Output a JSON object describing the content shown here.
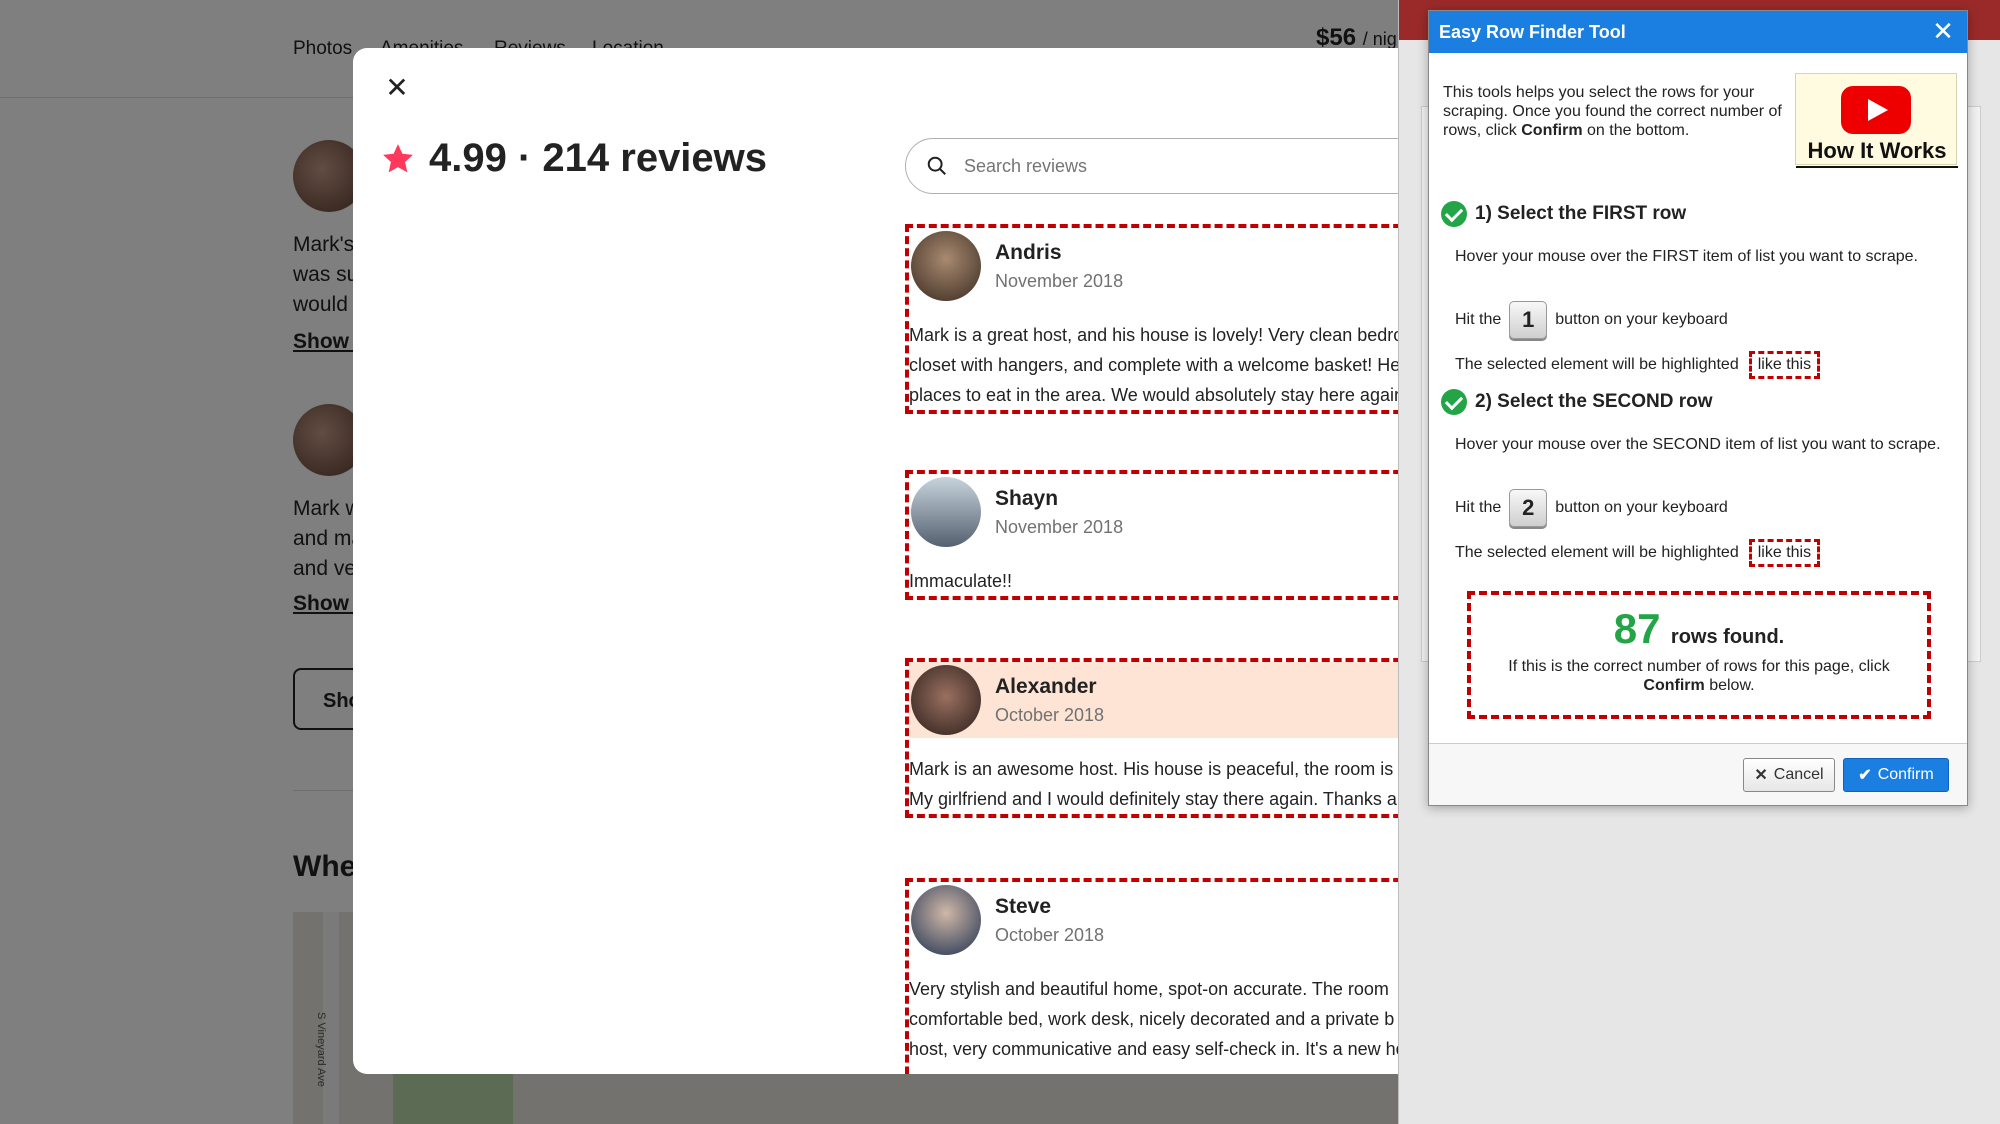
{
  "background": {
    "nav": [
      "Photos",
      "Amenities",
      "Reviews",
      "Location"
    ],
    "price": "$56",
    "price_unit": "/ nig",
    "snippets": [
      "Mark's",
      "was su",
      "would",
      "Mark w",
      "and ma",
      "and ve"
    ],
    "show_more": "Show r",
    "show_button": "Sho",
    "where_heading": "Whe",
    "map_label": "S Vineyard Ave"
  },
  "modal": {
    "rating": "4.99 · 214 reviews",
    "search_placeholder": "Search reviews",
    "reviews": [
      {
        "name": "Andris",
        "date": "November 2018",
        "lines": [
          "Mark is a great host, and his house is lovely! Very clean bedroo",
          "closet with hangers, and complete with a welcome basket! He",
          "places to eat in the area. We would absolutely stay here again"
        ]
      },
      {
        "name": "Shayn",
        "date": "November 2018",
        "lines": [
          "Immaculate!!"
        ]
      },
      {
        "name": "Alexander",
        "date": "October 2018",
        "lines": [
          "Mark is an awesome host. His house is peaceful, the room is sp",
          "My girlfriend and I would definitely stay there again. Thanks a"
        ]
      },
      {
        "name": "Steve",
        "date": "October 2018",
        "lines": [
          "Very stylish and beautiful home, spot-on accurate. The room",
          "comfortable bed, work desk, nicely decorated and a private b",
          "host, very communicative and easy self-check in. It's a new ho"
        ]
      }
    ]
  },
  "dialog": {
    "title": "Easy Row Finder Tool",
    "intro_pre": "This tools helps you select the rows for your scraping. Once you found the correct number of rows, click ",
    "intro_bold": "Confirm",
    "intro_post": " on the bottom.",
    "video_label": "How It Works",
    "step1": {
      "title": "1) Select the FIRST row",
      "text": "Hover your mouse over the FIRST item of list you want to scrape.",
      "hit_pre": "Hit the",
      "key": "1",
      "hit_post": "button on your keyboard",
      "highlight": "The selected element will be highlighted",
      "like_this": "like this"
    },
    "step2": {
      "title": "2) Select the SECOND row",
      "text": "Hover your mouse over the SECOND item of list you want to scrape.",
      "hit_pre": "Hit the",
      "key": "2",
      "hit_post": "button on your keyboard",
      "highlight": "The selected element will be highlighted",
      "like_this": "like this"
    },
    "rows_count": "87",
    "rows_label": "rows found.",
    "rows_note_pre": "If this is the correct number of rows for this page, click ",
    "rows_note_bold": "Confirm",
    "rows_note_post": " below.",
    "cancel_label": "Cancel",
    "confirm_label": "Confirm"
  },
  "colors": {
    "dialog_titlebar": "#1a7fe0",
    "highlight_dash": "#c00000",
    "rows_count": "#22a447",
    "airbnb_star": "#ff385c",
    "row_highlight": "#fde4d4"
  }
}
